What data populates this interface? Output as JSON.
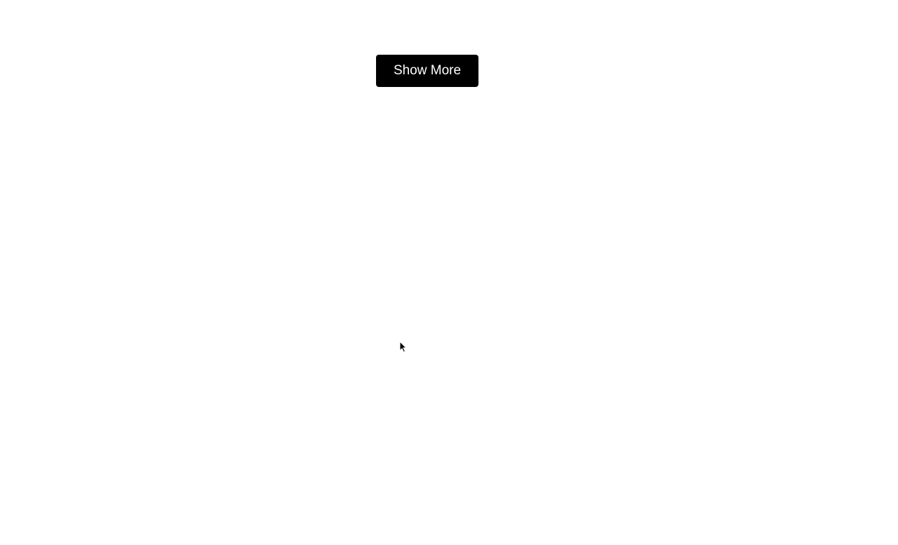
{
  "button": {
    "show_more_label": "Show More"
  }
}
